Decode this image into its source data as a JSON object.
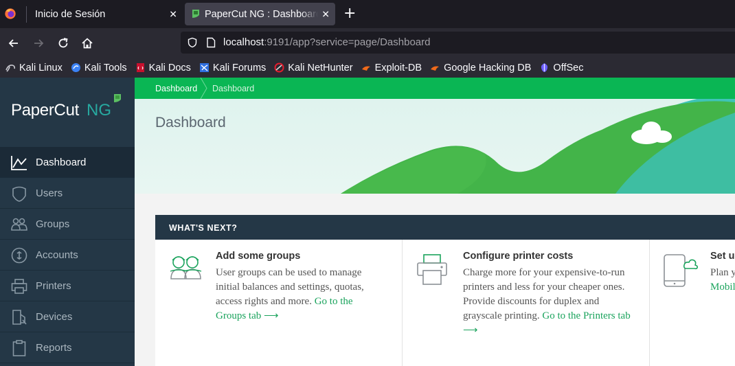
{
  "browser": {
    "tabs": [
      {
        "title": "Inicio de Sesión"
      },
      {
        "title": "PaperCut NG : Dashboard"
      }
    ],
    "url": {
      "host": "localhost",
      "rest": ":9191/app?service=page/Dashboard"
    },
    "bookmarks": [
      {
        "label": "Kali Linux",
        "icon": "kali-dragon-icon",
        "color": "#c9c9d0"
      },
      {
        "label": "Kali Tools",
        "icon": "kali-tools-icon",
        "color": "#3b82f6"
      },
      {
        "label": "Kali Docs",
        "icon": "kali-docs-icon",
        "color": "#e11d2e"
      },
      {
        "label": "Kali Forums",
        "icon": "kali-forums-icon",
        "color": "#2f6fe0"
      },
      {
        "label": "Kali NetHunter",
        "icon": "kali-nethunter-icon",
        "color": "#e11d2e"
      },
      {
        "label": "Exploit-DB",
        "icon": "exploit-db-icon",
        "color": "#f06a1a"
      },
      {
        "label": "Google Hacking DB",
        "icon": "ghdb-icon",
        "color": "#f06a1a"
      },
      {
        "label": "OffSec",
        "icon": "offsec-icon",
        "color": "#6b5cff"
      }
    ]
  },
  "app": {
    "logo": {
      "text": "PaperCut",
      "suffix": "NG"
    },
    "nav": [
      {
        "label": "Dashboard",
        "icon": "chart-line-icon"
      },
      {
        "label": "Users",
        "icon": "users-icon"
      },
      {
        "label": "Groups",
        "icon": "groups-icon"
      },
      {
        "label": "Accounts",
        "icon": "accounts-icon"
      },
      {
        "label": "Printers",
        "icon": "printer-icon"
      },
      {
        "label": "Devices",
        "icon": "devices-icon"
      },
      {
        "label": "Reports",
        "icon": "reports-icon"
      }
    ],
    "breadcrumb": [
      "Dashboard",
      "Dashboard"
    ],
    "page_title": "Dashboard",
    "whats_next": {
      "heading": "WHAT'S NEXT?",
      "cards": [
        {
          "title": "Add some groups",
          "text": "User groups can be used to manage initial balances and settings, quotas, access rights and more. ",
          "link": "Go to the Groups tab ⟶",
          "icon": "groups-illustration-icon"
        },
        {
          "title": "Configure printer costs",
          "text": "Charge more for your expensive-to-run printers and less for your cheaper ones. Provide discounts for duplex and grayscale printing. ",
          "link": "Go to the Printers tab ⟶",
          "icon": "printer-illustration-icon"
        },
        {
          "title": "Set up",
          "text": "Plan y mana",
          "link": "Mobil",
          "icon": "mobile-cloud-icon"
        }
      ]
    },
    "colors": {
      "green": "#0ab654",
      "sidebar": "#243746",
      "link": "#1aa35c"
    }
  }
}
